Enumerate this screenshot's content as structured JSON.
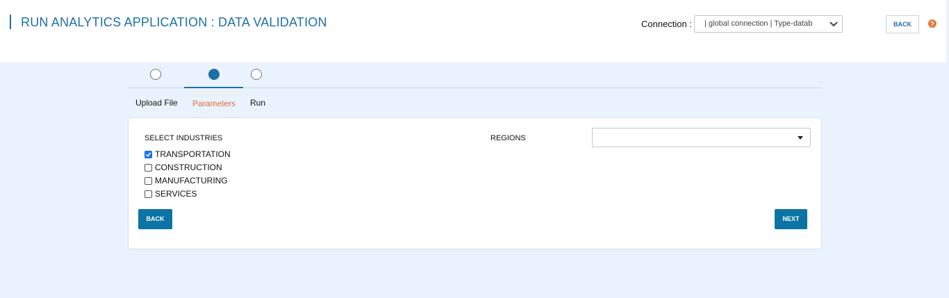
{
  "header": {
    "title": "RUN ANALYTICS APPLICATION : DATA VALIDATION",
    "connection_label": "Connection :",
    "connection_value": "| global connection | Type-datab",
    "back_label": "BACK"
  },
  "stepper": {
    "steps": [
      {
        "label": "Upload File",
        "state": "inactive"
      },
      {
        "label": "Parameters",
        "state": "active"
      },
      {
        "label": "Run",
        "state": "inactive"
      }
    ]
  },
  "form": {
    "select_industries_label": "SELECT INDUSTRIES",
    "industries": [
      {
        "label": "TRANSPORTATION",
        "checked": true
      },
      {
        "label": "CONSTRUCTION",
        "checked": false
      },
      {
        "label": "MANUFACTURING",
        "checked": false
      },
      {
        "label": "SERVICES",
        "checked": false
      }
    ],
    "regions_label": "REGIONS",
    "regions_value": "",
    "back_label": "BACK",
    "next_label": "NEXT"
  },
  "colors": {
    "accent": "#1e6fa8",
    "active_tab": "#e56a3c",
    "button": "#0b74a4",
    "help": "#e07b39",
    "background": "#eaf3fd"
  },
  "icons": [
    "chevron-down-icon",
    "help-icon",
    "caret-down-icon",
    "check-icon"
  ]
}
